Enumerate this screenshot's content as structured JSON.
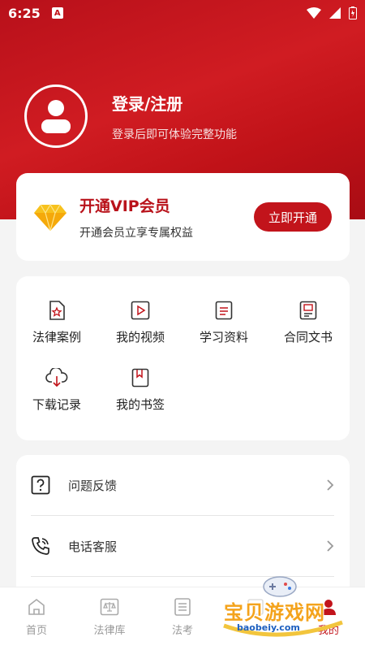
{
  "status_bar": {
    "time": "6:25",
    "a_icon": "A"
  },
  "profile": {
    "title": "登录/注册",
    "subtitle": "登录后即可体验完整功能"
  },
  "vip": {
    "title": "开通VIP会员",
    "subtitle": "开通会员立享专属权益",
    "button": "立即开通"
  },
  "grid": {
    "items": [
      {
        "label": "法律案例",
        "icon": "case-doc-icon"
      },
      {
        "label": "我的视频",
        "icon": "video-icon"
      },
      {
        "label": "学习资料",
        "icon": "study-doc-icon"
      },
      {
        "label": "合同文书",
        "icon": "contract-icon"
      },
      {
        "label": "下载记录",
        "icon": "download-cloud-icon"
      },
      {
        "label": "我的书签",
        "icon": "bookmark-icon"
      }
    ]
  },
  "list": {
    "items": [
      {
        "label": "问题反馈",
        "icon": "question-icon"
      },
      {
        "label": "电话客服",
        "icon": "phone-icon"
      }
    ]
  },
  "tabbar": {
    "tabs": [
      {
        "label": "首页",
        "icon": "home-icon"
      },
      {
        "label": "法律库",
        "icon": "scale-icon"
      },
      {
        "label": "法考",
        "icon": "exam-icon"
      },
      {
        "label": "",
        "icon": "hidden-tab"
      },
      {
        "label": "我的",
        "icon": "profile-icon"
      }
    ],
    "active_color": "#c2141b"
  },
  "watermark": {
    "text": "宝贝游戏网",
    "url": "baobeiy.com"
  },
  "colors": {
    "brand": "#c2141b"
  }
}
